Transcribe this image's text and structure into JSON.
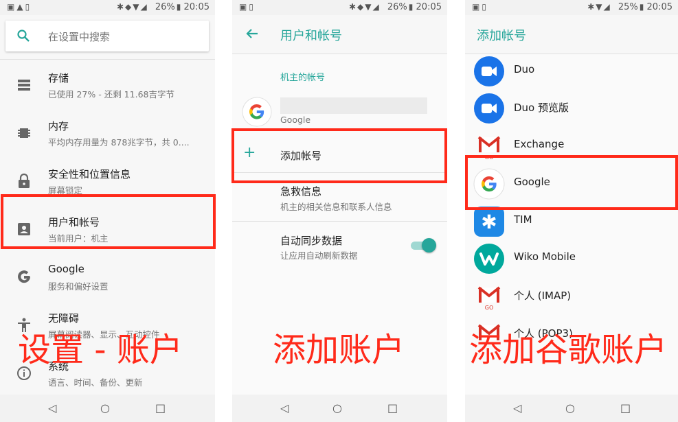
{
  "status": {
    "panel1": {
      "battery": "26%",
      "time": "20:05"
    },
    "panel2": {
      "battery": "26%",
      "time": "20:05"
    },
    "panel3": {
      "battery": "25%",
      "time": "20:05"
    }
  },
  "settings": {
    "search_placeholder": "在设置中搜索",
    "items": [
      {
        "title": "存储",
        "subtitle": "已使用 27% - 还剩 11.68吉字节",
        "icon": "storage-icon"
      },
      {
        "title": "内存",
        "subtitle": "平均内存用量为 878兆字节，共 0....",
        "icon": "memory-icon"
      },
      {
        "title": "安全性和位置信息",
        "subtitle": "屏幕锁定",
        "icon": "lock-icon"
      },
      {
        "title": "用户和帐号",
        "subtitle": "当前用户：机主",
        "icon": "account-box-icon"
      },
      {
        "title": "Google",
        "subtitle": "服务和偏好设置",
        "icon": "google-g-icon"
      },
      {
        "title": "无障碍",
        "subtitle": "屏幕阅读器、显示、互动控件",
        "icon": "accessibility-icon"
      },
      {
        "title": "系统",
        "subtitle": "语言、时间、备份、更新",
        "icon": "info-icon"
      }
    ]
  },
  "accounts": {
    "title": "用户和帐号",
    "category": "机主的帐号",
    "google_account_label": "Google",
    "add_account": "添加帐号",
    "emergency_title": "急救信息",
    "emergency_sub": "机主的相关信息和联系人信息",
    "autosync_title": "自动同步数据",
    "autosync_sub": "让应用自动刷新数据",
    "autosync_on": true
  },
  "add_account": {
    "title": "添加帐号",
    "items": [
      {
        "name": "Duo",
        "icon": "duo-icon"
      },
      {
        "name": "Duo 预览版",
        "icon": "duo-preview-icon"
      },
      {
        "name": "Exchange",
        "icon": "gmail-go-icon"
      },
      {
        "name": "Google",
        "icon": "google-g-icon"
      },
      {
        "name": "TIM",
        "icon": "tim-icon"
      },
      {
        "name": "Wiko Mobile",
        "icon": "wiko-icon"
      },
      {
        "name": "个人 (IMAP)",
        "icon": "gmail-go-icon"
      },
      {
        "name": "个人 (POP3)",
        "icon": "gmail-go-icon"
      }
    ]
  },
  "captions": {
    "c1": "设置 - 账户",
    "c2": "添加账户",
    "c3": "添加谷歌账户"
  },
  "colors": {
    "accent": "#26a69a",
    "highlight": "#ff2a1a"
  }
}
